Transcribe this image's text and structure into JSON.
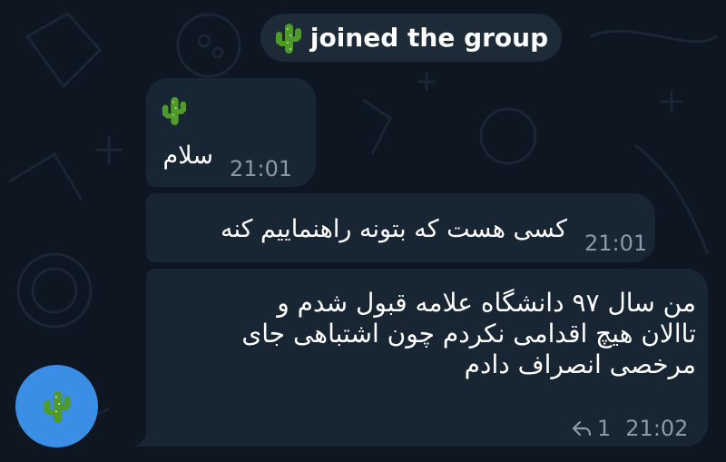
{
  "colors": {
    "background": "#0e1621",
    "bubble": "#182533",
    "service_bubble": "#1d2a37",
    "avatar": "#3a8ee6",
    "muted_text": "#8a9aa9",
    "cactus": "#4e9a2a"
  },
  "service_message": {
    "icon": "cactus-emoji-icon",
    "text": "joined the group"
  },
  "messages": [
    {
      "emoji": "cactus-emoji-icon",
      "text": "سلام",
      "time": "21:01"
    },
    {
      "text": "کسی هست که بتونه راهنماییم کنه",
      "time": "21:01"
    },
    {
      "lines": [
        "من سال ۹۷ دانشگاه علامه قبول شدم و",
        "تاالان هیچ اقدامی نکردم چون اشتباهی جای",
        "مرخصی انصراف دادم"
      ],
      "replies": "1",
      "time": "21:02"
    }
  ],
  "sender_avatar": {
    "icon": "cactus-emoji-icon"
  }
}
